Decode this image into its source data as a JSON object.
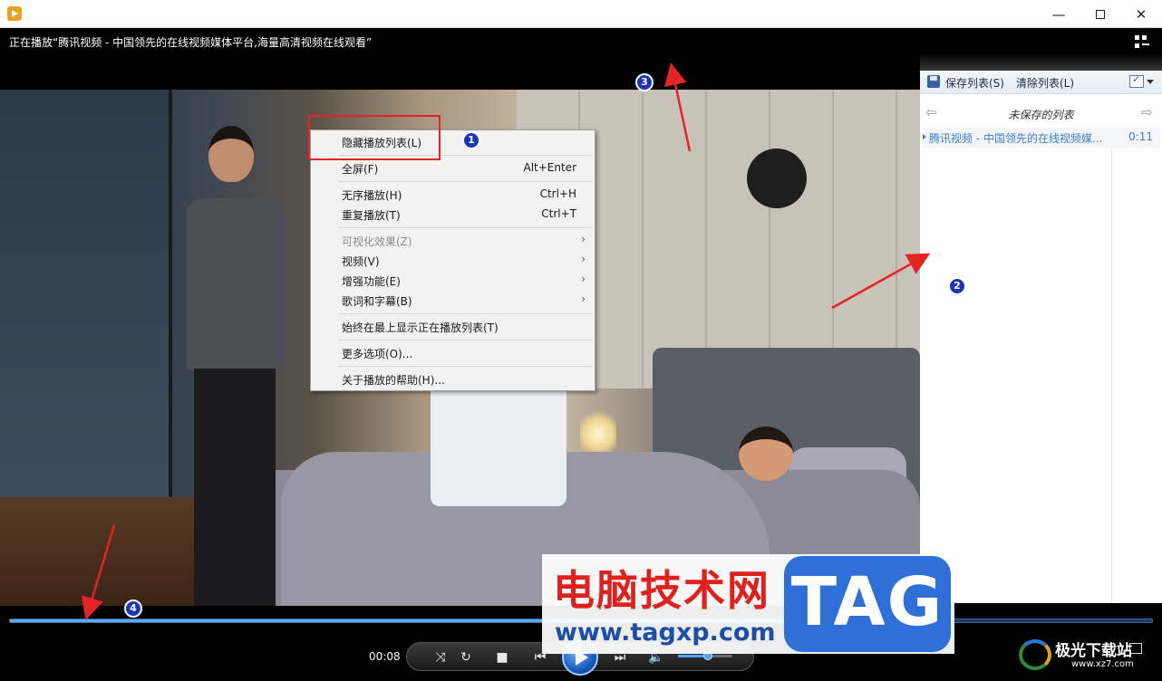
{
  "window": {
    "minimize_glyph": "—",
    "maximize_glyph": "",
    "close_glyph": "✕",
    "now_playing": "正在播放“腾讯视频 - 中国领先的在线视频媒体平台,海量高清视频在线观看”"
  },
  "playlist": {
    "save_label": "保存列表(S)",
    "clear_label": "清除列表(L)",
    "title": "未保存的列表",
    "back_glyph": "⇦",
    "forward_glyph": "⇨",
    "items": [
      {
        "name": "腾讯视频 - 中国领先的在线视频媒...",
        "duration": "0:11"
      }
    ]
  },
  "context_menu": {
    "items": [
      {
        "label": "隐藏播放列表(L)",
        "shortcut": ""
      },
      {
        "label": "全屏(F)",
        "shortcut": "Alt+Enter"
      },
      {
        "label": "无序播放(H)",
        "shortcut": "Ctrl+H"
      },
      {
        "label": "重复播放(T)",
        "shortcut": "Ctrl+T"
      },
      {
        "label": "可视化效果(Z)",
        "shortcut": "",
        "disabled": true,
        "submenu": true
      },
      {
        "label": "视频(V)",
        "shortcut": "",
        "submenu": true
      },
      {
        "label": "增强功能(E)",
        "shortcut": "",
        "submenu": true
      },
      {
        "label": "歌词和字幕(B)",
        "shortcut": "",
        "submenu": true
      },
      {
        "label": "始终在最上显示正在播放列表(T)",
        "shortcut": ""
      },
      {
        "label": "更多选项(O)...",
        "shortcut": ""
      },
      {
        "label": "关于播放的帮助(H)...",
        "shortcut": ""
      }
    ],
    "submenu_glyph": "›"
  },
  "annotations": {
    "badge_1": "1",
    "badge_2": "2",
    "badge_3": "3",
    "badge_4": "4",
    "color": "#e42323"
  },
  "player": {
    "time": "00:08",
    "progress_fraction": 0.72,
    "volume_fraction": 0.55,
    "shuffle_glyph": "⤨",
    "repeat_glyph": "↻",
    "stop_glyph": "■",
    "prev_glyph": "⏮",
    "next_glyph": "⏭",
    "volume_glyph": "🔈"
  },
  "watermark": {
    "site_name": "电脑技术网",
    "site_url": "www.tagxp.com",
    "tag": "TAG",
    "site2_name": "极光下载站",
    "site2_url": "www.xz7.com"
  },
  "colors": {
    "accent": "#3b7fd4",
    "highlight": "#e42323",
    "badge": "#1a35b8"
  }
}
